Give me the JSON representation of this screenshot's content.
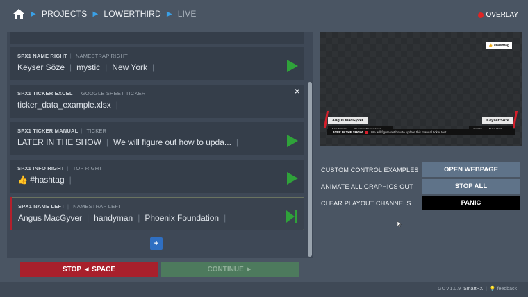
{
  "breadcrumb": {
    "items": [
      "PROJECTS",
      "LOWERTHIRD",
      "LIVE"
    ]
  },
  "overlay_label": "OVERLAY",
  "rundown": {
    "items": [
      {
        "title": "SPX1 NAME RIGHT",
        "template": "NAMESTRAP RIGHT",
        "fields": [
          "Keyser Söze",
          "mystic",
          "New York"
        ],
        "control": "play-icon"
      },
      {
        "title": "SPX1 TICKER EXCEL",
        "template": "GOOGLE SHEET TICKER",
        "fields": [
          "ticker_data_example.xlsx"
        ],
        "control": "close-icon"
      },
      {
        "title": "SPX1 TICKER MANUAL",
        "template": "TICKER",
        "fields": [
          "LATER IN THE SHOW",
          "We will figure out how to upda..."
        ],
        "control": "play-icon"
      },
      {
        "title": "SPX1 INFO RIGHT",
        "template": "TOP RIGHT",
        "fields": [
          "👍 #hashtag"
        ],
        "control": "play-icon"
      },
      {
        "title": "SPX1 NAME LEFT",
        "template": "NAMESTRAP LEFT",
        "fields": [
          "Angus MacGyver",
          "handyman",
          "Phoenix Foundation"
        ],
        "control": "next-icon",
        "active": true
      }
    ],
    "add_label": "+"
  },
  "buttons": {
    "stop": "STOP ◄ SPACE",
    "continue": "CONTINUE ►"
  },
  "preview": {
    "hashtag": "👍 #hashtag",
    "left_name": "Angus MacGyver",
    "left_title": "handyman",
    "left_org": "Phoenix Foundation",
    "right_name": "Keyser Söze",
    "right_title": "mystic",
    "right_org": "New York",
    "ticker_head": "LATER IN THE SHOW",
    "ticker_text": "We will figure out how to update this manual ticker text"
  },
  "custom_controls": [
    {
      "label": "CUSTOM CONTROL EXAMPLES",
      "button": "OPEN WEBPAGE"
    },
    {
      "label": "ANIMATE ALL GRAPHICS OUT",
      "button": "STOP ALL"
    },
    {
      "label": "CLEAR PLAYOUT CHANNELS",
      "button": "PANIC"
    }
  ],
  "footer": {
    "version": "GC v.1.0.9",
    "brand": "SmartPX",
    "feedback": "💡 feedback"
  },
  "colors": {
    "accent_blue": "#3aa0e6",
    "play_green": "#2fa23a",
    "stop_red": "#a8202c",
    "overlay_red": "#e02424"
  }
}
